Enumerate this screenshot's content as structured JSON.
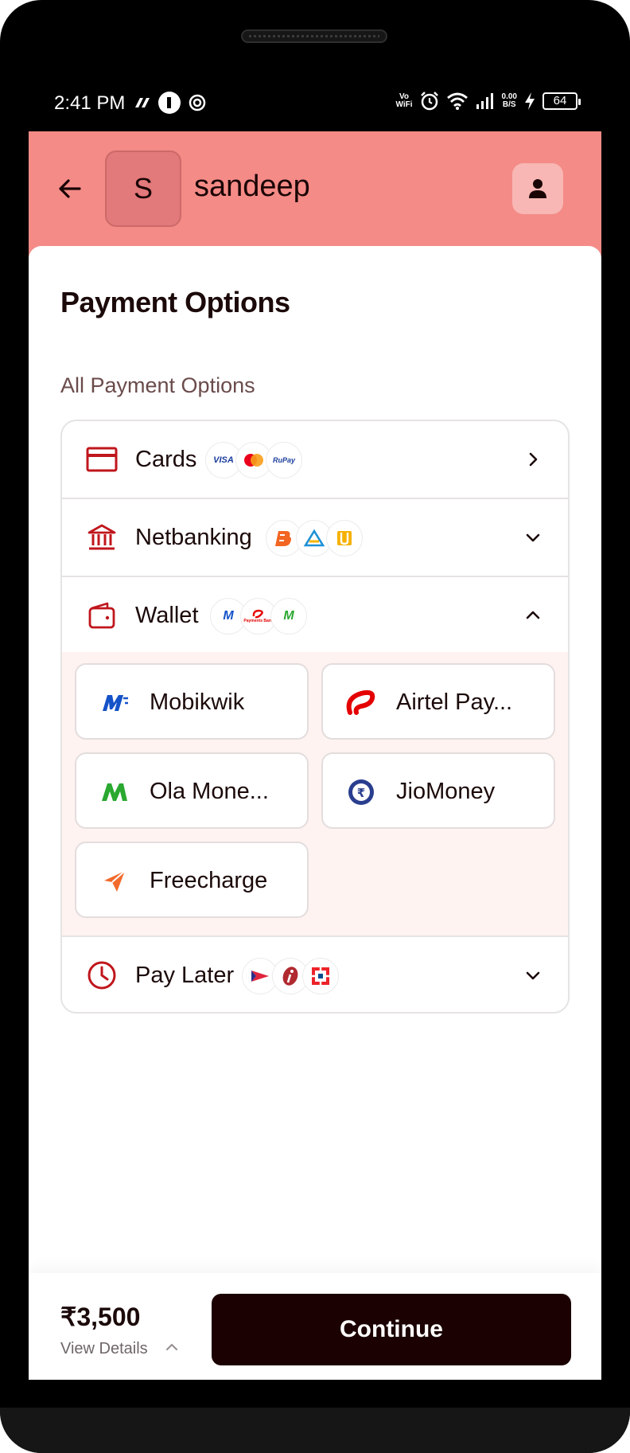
{
  "status_bar": {
    "time": "2:41 PM",
    "vo_wifi": "Vo\nWiFi",
    "net_speed": "0.00",
    "net_unit": "B/S",
    "battery": "64"
  },
  "header": {
    "avatar_initial": "S",
    "merchant_name": "sandeep"
  },
  "page": {
    "title": "Payment Options",
    "section_label": "All Payment Options"
  },
  "options": [
    {
      "label": "Cards",
      "logos": [
        "VISA",
        "MC",
        "RuPay"
      ],
      "state": "collapsed-right"
    },
    {
      "label": "Netbanking",
      "logos": [
        "BOB",
        "SBI",
        "PNB"
      ],
      "state": "collapsed"
    },
    {
      "label": "Wallet",
      "logos": [
        "Mobikwik",
        "Airtel",
        "Ola"
      ],
      "state": "expanded"
    },
    {
      "label": "Pay Later",
      "logos": [
        "Lazy",
        "ICICI",
        "HDFC"
      ],
      "state": "collapsed"
    }
  ],
  "wallets": [
    {
      "label": "Mobikwik"
    },
    {
      "label": "Airtel Pay..."
    },
    {
      "label": "Ola Mone..."
    },
    {
      "label": "JioMoney"
    },
    {
      "label": "Freecharge"
    }
  ],
  "logo_text": {
    "visa": "VISA",
    "rupay": "RuPay",
    "airtel_small": "Payments Bank"
  },
  "footer": {
    "amount": "₹3,500",
    "view_details": "View Details",
    "continue_label": "Continue"
  },
  "colors": {
    "header_bg": "#f48b87",
    "accent_red": "#c0161c",
    "continue_bg": "#1b0101",
    "wallet_panel_bg": "#fff3f1"
  },
  "icons": {
    "back": "arrow-left-icon",
    "profile": "user-icon",
    "cards": "credit-card-icon",
    "netbanking": "bank-icon",
    "wallet": "wallet-icon",
    "paylater": "clock-icon",
    "chevron_right": "chevron-right-icon",
    "chevron_down": "chevron-down-icon",
    "chevron_up": "chevron-up-icon"
  }
}
